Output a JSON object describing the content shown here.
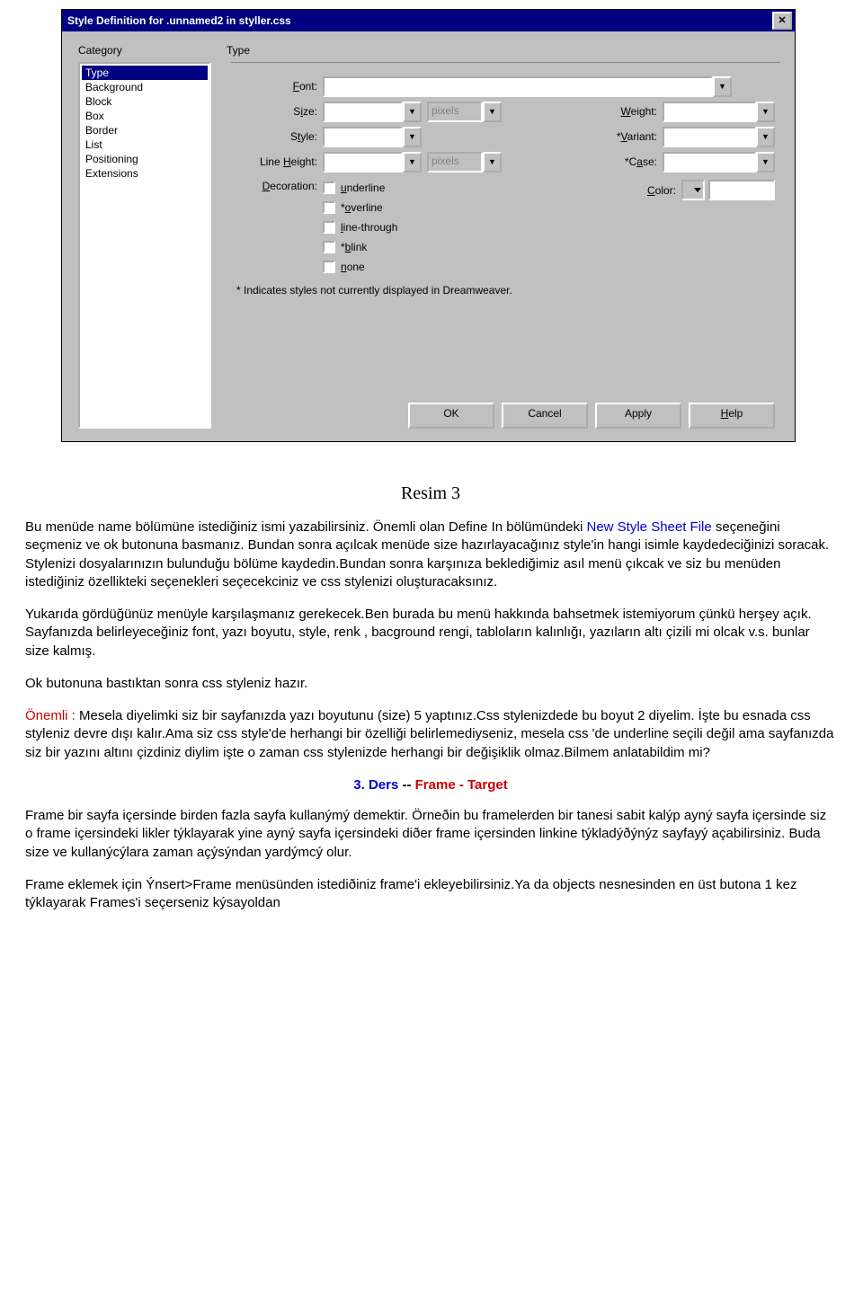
{
  "dialog": {
    "title": "Style Definition for .unnamed2 in styller.css",
    "close": "✕",
    "category_label": "Category",
    "type_label": "Type",
    "categories": [
      "Type",
      "Background",
      "Block",
      "Box",
      "Border",
      "List",
      "Positioning",
      "Extensions"
    ],
    "labels": {
      "font": "Font:",
      "size": "Size:",
      "style": "Style:",
      "lineheight": "Line Height:",
      "decoration": "Decoration:",
      "weight": "Weight:",
      "variant": "*Variant:",
      "case": "*Case:",
      "color": "Color:",
      "pixels": "pixels"
    },
    "decorations": {
      "underline": "underline",
      "overline": "*overline",
      "linethrough": "line-through",
      "blink": "*blink",
      "none": "none"
    },
    "footnote": "* Indicates styles not currently displayed in Dreamweaver.",
    "buttons": {
      "ok": "OK",
      "cancel": "Cancel",
      "apply": "Apply",
      "help": "Help"
    }
  },
  "doc": {
    "caption": "Resim 3",
    "p1a": "Bu menüde name bölümüne istediğiniz ismi yazabilirsiniz. Önemli olan Define In bölümündeki ",
    "p1b": "New Style Sheet File",
    "p1c": " seçeneğini seçmeniz ve ok butonuna basmanız. Bundan sonra açılcak menüde size hazırlayacağınız style'in hangi isimle kaydedeciğinizi soracak. Stylenizi dosyalarınızın bulunduğu bölüme kaydedin.Bundan sonra karşınıza beklediğimiz asıl menü çıkcak ve siz bu menüden istediğiniz özellikteki seçenekleri seçecekciniz ve css stylenizi oluşturacaksınız.",
    "p2": "Yukarıda gördüğünüz menüyle karşılaşmanız gerekecek.Ben burada bu menü hakkında bahsetmek istemiyorum çünkü herşey açık. Sayfanızda belirleyeceğiniz font, yazı boyutu, style, renk , bacground rengi, tabloların kalınlığı, yazıların altı çizili mi olcak v.s. bunlar size kalmış.",
    "p3": "Ok butonuna bastıktan sonra css styleniz hazır.",
    "p4a": "Önemli :",
    "p4b": " Mesela diyelimki siz bir sayfanızda yazı boyutunu (size) 5 yaptınız.Css stylenizdede bu boyut 2 diyelim. İşte bu esnada css styleniz devre dışı kalır.Ama siz css style'de herhangi bir özelliği belirlemediyseniz, mesela css 'de underline seçili değil ama sayfanızda siz bir yazını altını çizdiniz diylim işte o zaman css stylenizde herhangi bir değişiklik olmaz.Bilmem anlatabildim mi?",
    "h3a": "3. Ders",
    "h3b": " -- ",
    "h3c": "Frame - Target",
    "p5": "Frame bir sayfa içersinde birden fazla sayfa kullanýmý demektir. Örneðin bu framelerden bir tanesi sabit kalýp ayný sayfa içersinde siz o frame içersindeki likler týklayarak yine ayný sayfa içersindeki diðer frame içersinden linkine týkladýðýnýz sayfayý açabilirsiniz. Buda size ve kullanýcýlara zaman açýsýndan yardýmcý olur.",
    "p6": "Frame eklemek için Ýnsert>Frame menüsünden istediðiniz frame'i ekleyebilirsiniz.Ya da objects nesnesinden en üst butona 1 kez týklayarak Frames'i seçerseniz kýsayoldan"
  }
}
